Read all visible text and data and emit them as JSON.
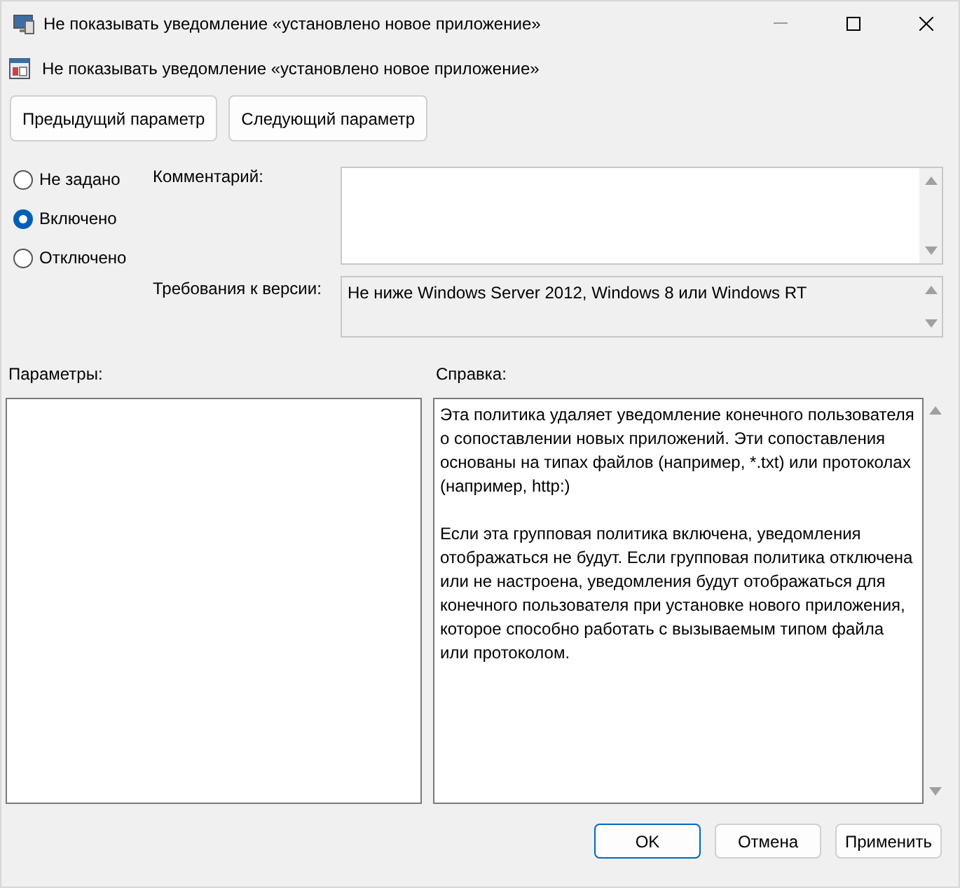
{
  "window": {
    "title": "Не показывать уведомление «установлено новое приложение»"
  },
  "policy_title": "Не показывать уведомление «установлено новое приложение»",
  "nav_buttons": [
    "Предыдущий параметр",
    "Следующий параметр"
  ],
  "states": [
    {
      "label": "Не задано",
      "selected": false
    },
    {
      "label": "Включено",
      "selected": true
    },
    {
      "label": "Отключено",
      "selected": false
    }
  ],
  "comment": {
    "label": "Комментарий:"
  },
  "requirements": {
    "label": "Требования к версии:",
    "value": "Не ниже Windows Server 2012, Windows 8 или Windows RT"
  },
  "options": {
    "label": "Параметры:"
  },
  "help": {
    "label": "Справка:",
    "paragraphs": [
      "Эта политика удаляет уведомление конечного пользователя о сопоставлении новых приложений. Эти сопоставления основаны на типах файлов (например, *.txt) или протоколах (например, http:)",
      "Если эта групповая политика включена, уведомления отображаться не будут. Если групповая политика отключена или не настроена, уведомления будут отображаться для конечного пользователя при установке нового приложения, которое способно работать с вызываемым типом файла или протоколом."
    ]
  },
  "buttons": [
    {
      "label": "OK",
      "kind": "primary"
    },
    {
      "label": "Отмена",
      "kind": "normal"
    },
    {
      "label": "Применить",
      "kind": "normal"
    }
  ]
}
